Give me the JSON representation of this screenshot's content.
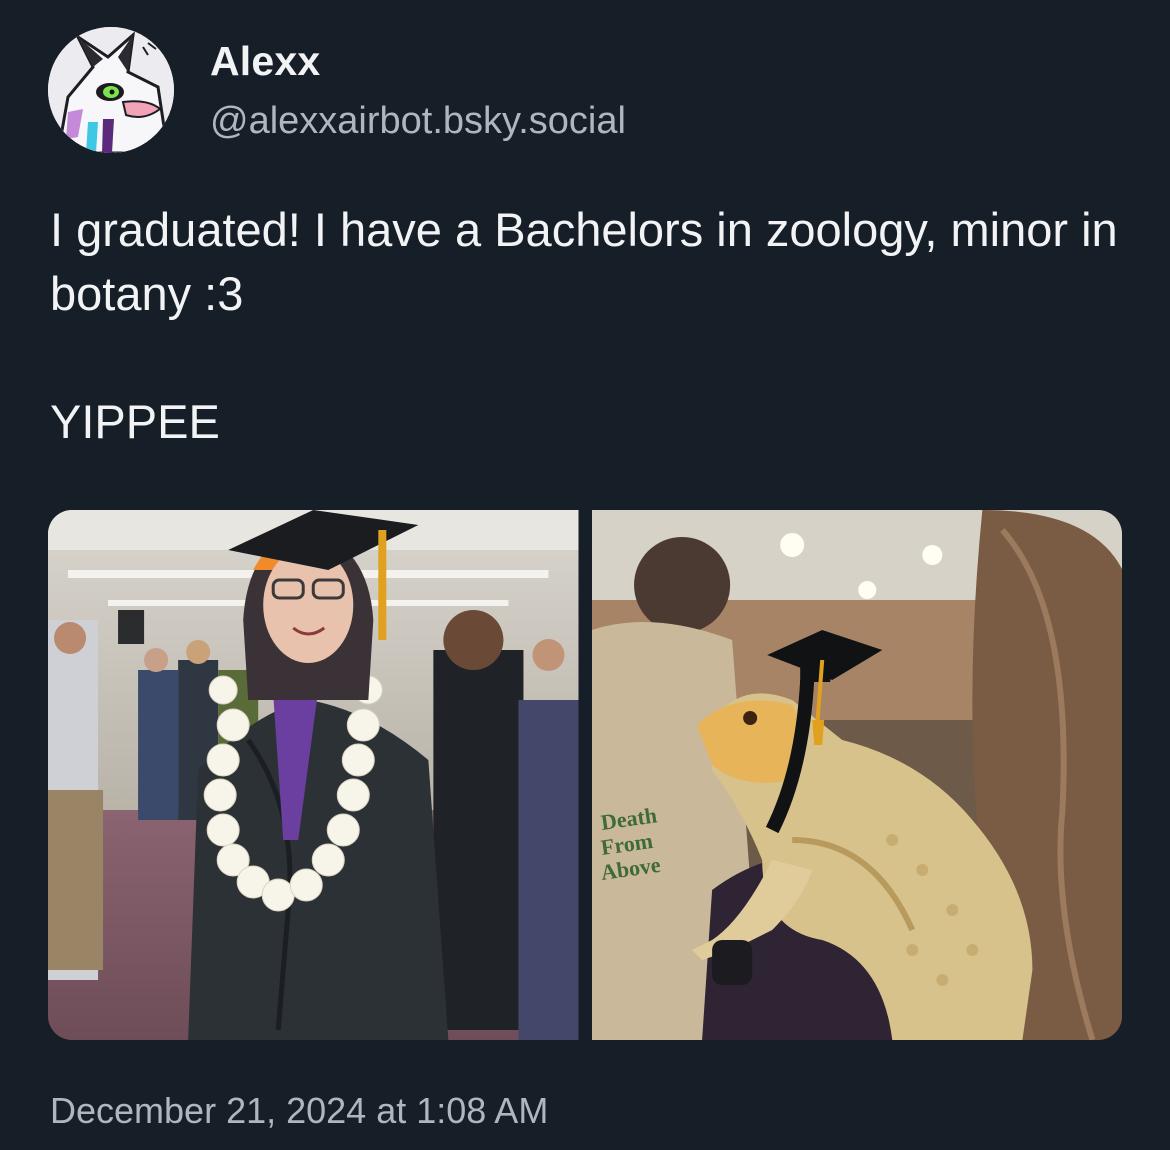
{
  "author": {
    "display_name": "Alexx",
    "handle": "@alexxairbot.bsky.social",
    "avatar_icon": "fox-character-avatar"
  },
  "post": {
    "lines": [
      "I graduated! I have a Bachelors in zoology, minor in botany :3",
      "YIPPEE"
    ],
    "timestamp": "December 21, 2024 at 1:08 AM"
  },
  "images": [
    {
      "subject": "graduate in cap and gown with white lei"
    },
    {
      "subject": "bearded dragon wearing tiny graduation cap",
      "sweatshirt_text": [
        "Death",
        "From",
        "Above"
      ]
    }
  ],
  "colors": {
    "background": "#161e27",
    "text_primary": "#f1f3f5",
    "text_secondary": "#aeb6c0"
  }
}
